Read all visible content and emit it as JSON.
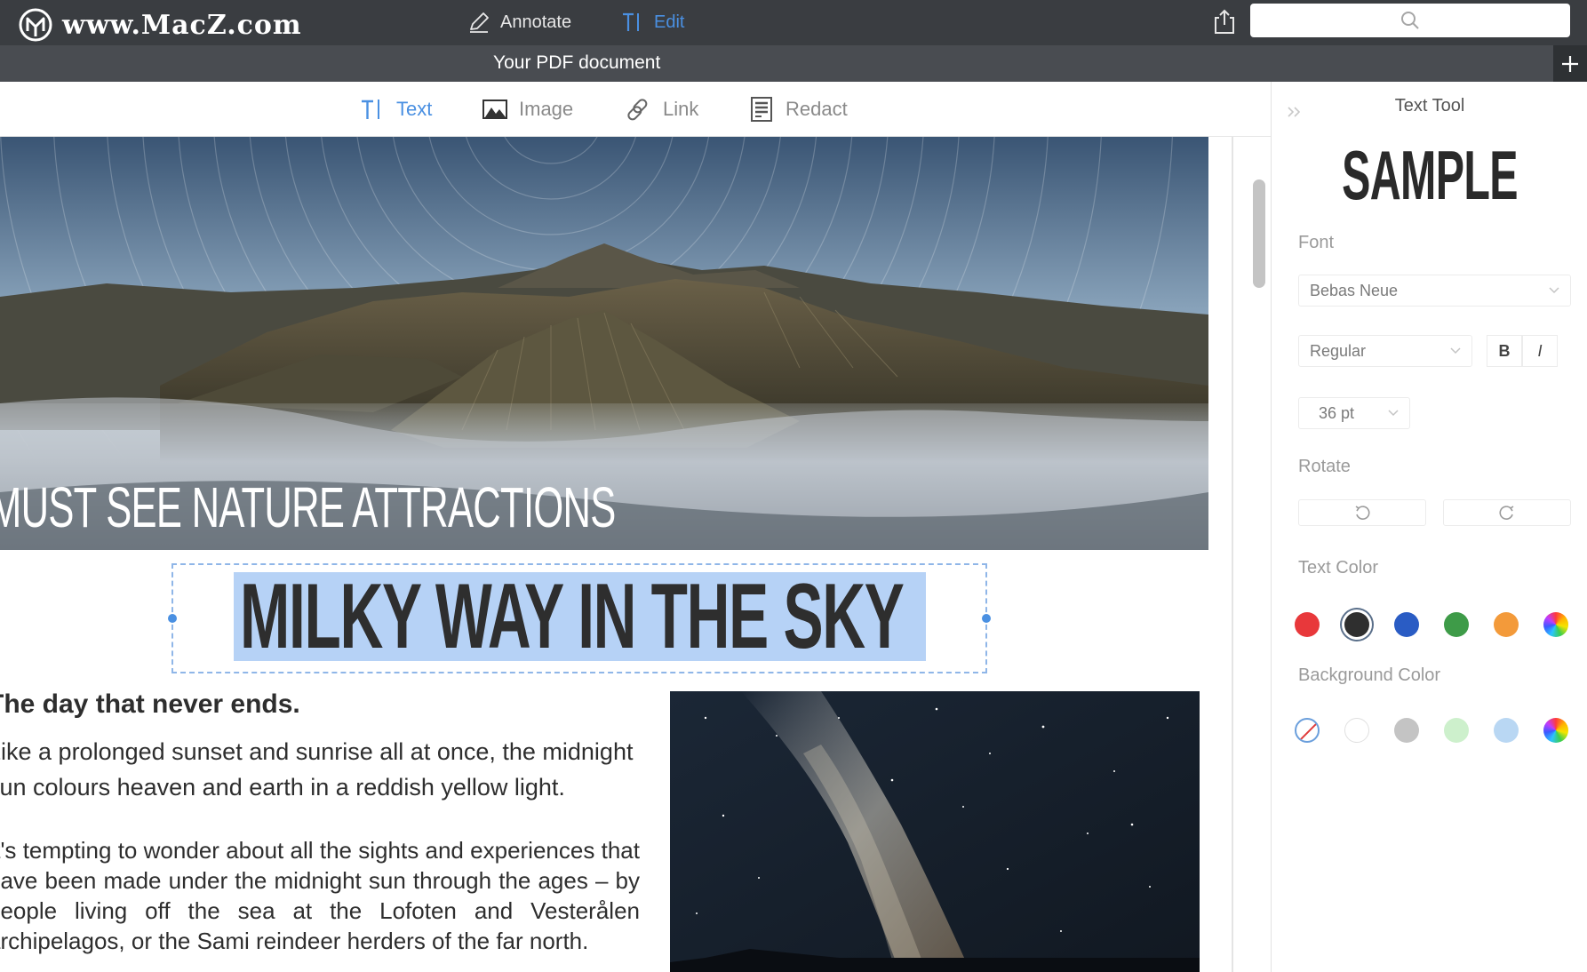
{
  "app": {
    "brand": "www.MacZ.com",
    "modes": [
      {
        "label": "Annotate",
        "icon": "pen-icon"
      },
      {
        "label": "Edit",
        "icon": "text-cursor-icon"
      }
    ],
    "active_mode": "Edit",
    "search": {
      "value": "",
      "placeholder": ""
    }
  },
  "document": {
    "title": "Your PDF document"
  },
  "toolbar": {
    "tools": [
      {
        "label": "Text",
        "icon": "text-cursor-icon"
      },
      {
        "label": "Image",
        "icon": "image-icon"
      },
      {
        "label": "Link",
        "icon": "link-icon"
      },
      {
        "label": "Redact",
        "icon": "redact-icon"
      }
    ],
    "active_tool": "Text"
  },
  "page": {
    "hero_caption": "MUST SEE NATURE ATTRACTIONS",
    "selected_heading": "MILKY WAY IN THE SKY",
    "sub_heading": "The day that never ends.",
    "paragraph_1": "Like a prolonged sunset and sunrise all at once, the midnight sun colours heaven and earth in a reddish yellow light.",
    "paragraph_2": "It's tempting to wonder about all the sights and experiences that have been made under the midnight sun through the ages – by people living off the sea at the Lofoten and Vesterålen archipelagos, or the Sami reindeer herders of the far north."
  },
  "panel": {
    "title": "Text Tool",
    "preview": "SAMPLE",
    "font_label": "Font",
    "font_family": "Bebas Neue",
    "font_style": "Regular",
    "bold_label": "B",
    "italic_label": "I",
    "font_size": "36 pt",
    "rotate_label": "Rotate",
    "text_color_label": "Text Color",
    "text_colors": [
      "#e8383b",
      "#2f2f2f",
      "#2a5cc4",
      "#3e9b48",
      "#f39a3a",
      "rainbow"
    ],
    "text_color_selected": "#2f2f2f",
    "background_color_label": "Background Color",
    "background_colors": [
      "none",
      "#ffffff",
      "#c4c4c4",
      "#cdf0cc",
      "#b9d7f3",
      "rainbow"
    ],
    "background_color_selected": "none"
  },
  "colors": {
    "titlebar": "#3a3d41",
    "docbar": "#494c51",
    "accent": "#4a90e2",
    "selection": "#b6d2f6"
  }
}
